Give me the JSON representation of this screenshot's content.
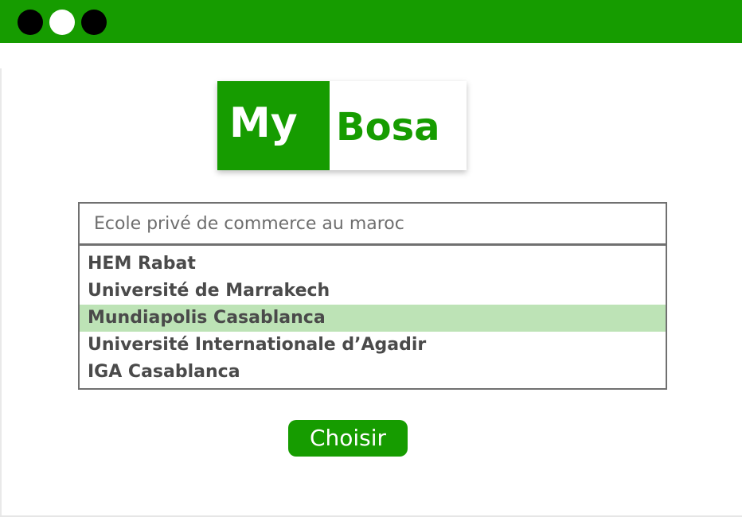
{
  "window": {
    "controls": [
      "close-dot",
      "minimize-dot",
      "maximize-dot"
    ]
  },
  "logo": {
    "part1": "My",
    "part2": "Bosa"
  },
  "search": {
    "placeholder": "Ecole privé de commerce au maroc"
  },
  "dropdown": {
    "options": [
      "HEM Rabat",
      "Université de Marrakech",
      "Mundiapolis Casablanca",
      "Université Internationale d’Agadir",
      "IGA Casablanca"
    ],
    "selected": "Mundiapolis Casablanca"
  },
  "actions": {
    "choose_label": "Choisir"
  },
  "colors": {
    "brand_green": "#169c00",
    "highlight_green": "#bde3b6",
    "border_gray": "#707070",
    "text_gray": "#4a4a4a"
  }
}
